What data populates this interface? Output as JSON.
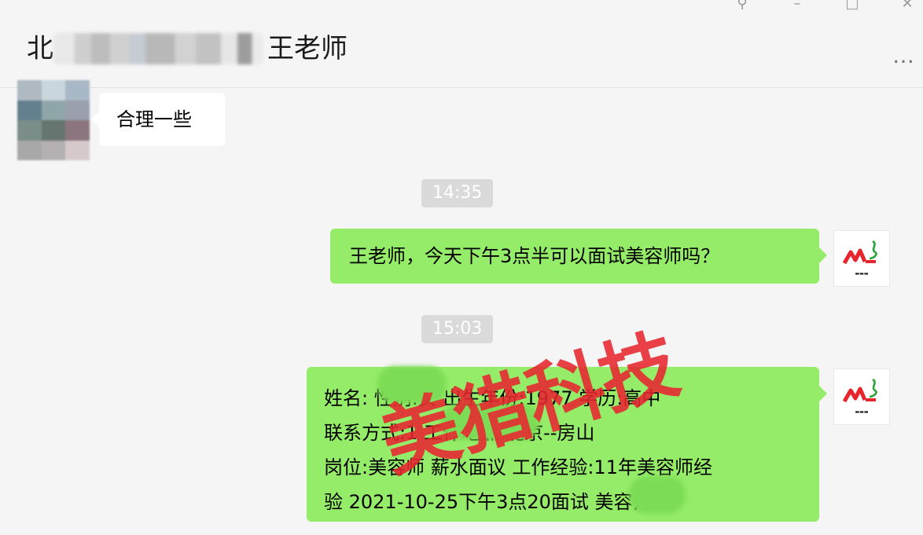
{
  "window": {
    "pin_icon": "pin-icon",
    "minimize_icon": "minimize-icon",
    "maximize_icon": "maximize-icon",
    "close_icon": "close-icon"
  },
  "header": {
    "title_prefix": "北",
    "title_suffix": "王老师",
    "more_icon": "more-dots-icon"
  },
  "messages": {
    "incoming_1": "合理一些",
    "time_1": "14:35",
    "outgoing_1": "王老师，今天下午3点半可以面试美容师吗？",
    "time_2": "15:03",
    "outgoing_2_lines": [
      "姓名:  性别:女 出生年份:1977 学历:高中",
      "联系方式:1 工作地点:北京--房山",
      "岗位:美容师 薪水面议 工作经验:11年美容师经",
      "验 2021-10-25下午3点20面试  美容师"
    ]
  },
  "watermark": {
    "text": "美猎科技",
    "color": "#e8262f"
  },
  "colors": {
    "bubble_green": "#95ec69",
    "bubble_white": "#ffffff",
    "background": "#f5f5f5"
  }
}
